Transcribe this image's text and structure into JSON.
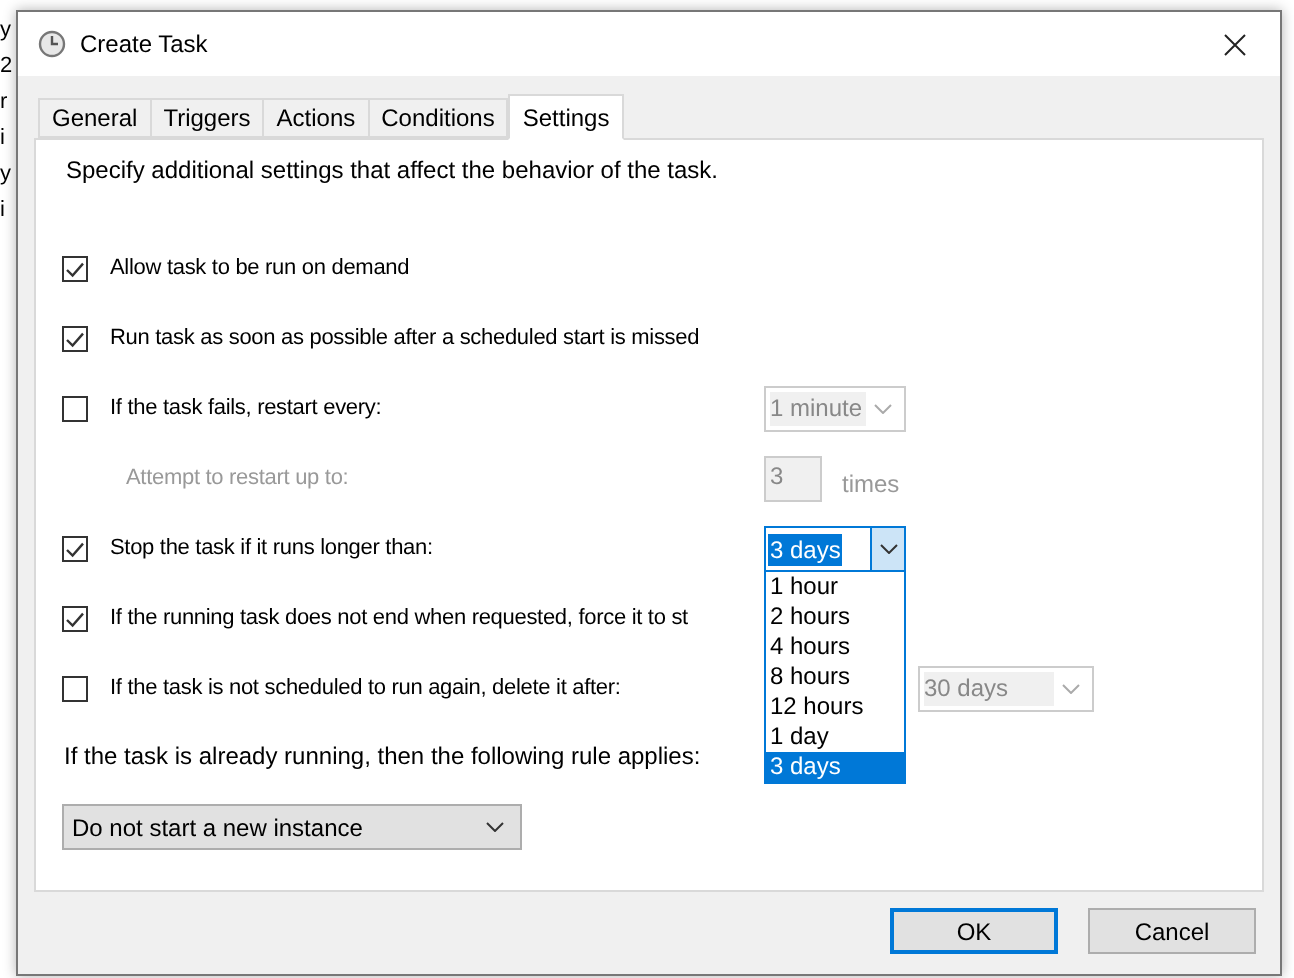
{
  "background": {
    "left_fragments": [
      "y",
      "2",
      "r",
      "i",
      "y",
      "i"
    ]
  },
  "window": {
    "title": "Create Task"
  },
  "tabs": [
    {
      "label": "General",
      "selected": false
    },
    {
      "label": "Triggers",
      "selected": false
    },
    {
      "label": "Actions",
      "selected": false
    },
    {
      "label": "Conditions",
      "selected": false
    },
    {
      "label": "Settings",
      "selected": true
    }
  ],
  "settings": {
    "description": "Specify additional settings that affect the behavior of the task.",
    "rows": [
      {
        "kind": "checkbox",
        "label": "Allow task to be run on demand",
        "checked": true
      },
      {
        "kind": "checkbox",
        "label": "Run task as soon as possible after a scheduled start is missed",
        "checked": true
      },
      {
        "kind": "checkbox",
        "label": "If the task fails, restart every:",
        "checked": false,
        "control": {
          "kind": "select",
          "value": "1 minute",
          "disabled": true,
          "expanded": false
        }
      },
      {
        "kind": "indent",
        "label": "Attempt to restart up to:",
        "disabled": true,
        "control": {
          "kind": "number",
          "value": "3",
          "unit": "times",
          "disabled": true
        }
      },
      {
        "kind": "checkbox",
        "label": "Stop the task if it runs longer than:",
        "checked": true,
        "control": {
          "kind": "select",
          "value": "3 days",
          "expanded": true,
          "options": [
            {
              "label": "1 hour",
              "selected": false
            },
            {
              "label": "2 hours",
              "selected": false
            },
            {
              "label": "4 hours",
              "selected": false
            },
            {
              "label": "8 hours",
              "selected": false
            },
            {
              "label": "12 hours",
              "selected": false
            },
            {
              "label": "1 day",
              "selected": false
            },
            {
              "label": "3 days",
              "selected": true
            }
          ]
        }
      },
      {
        "kind": "checkbox",
        "label": "If the running task does not end when requested, force it to st",
        "checked": true
      },
      {
        "kind": "checkbox",
        "label": "If the task is not scheduled to run again, delete it after:",
        "checked": false,
        "control": {
          "kind": "select",
          "value": "30 days",
          "disabled": true,
          "expanded": false,
          "wide": true
        }
      }
    ],
    "rule_label": "If the task is already running, then the following rule applies:",
    "rule_select": {
      "value": "Do not start a new instance"
    }
  },
  "buttons": [
    {
      "label": "OK",
      "default": true
    },
    {
      "label": "Cancel",
      "default": false
    }
  ]
}
